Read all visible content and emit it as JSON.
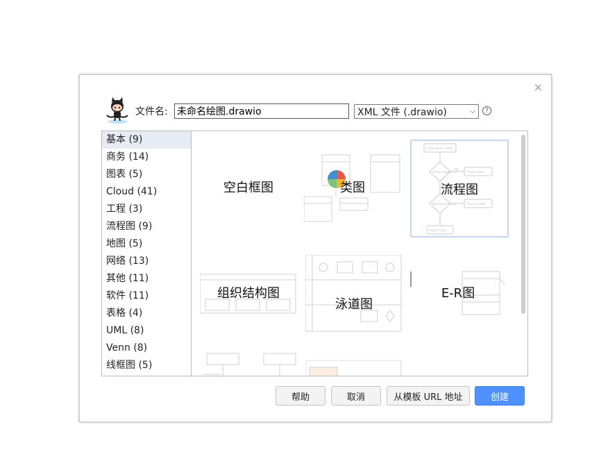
{
  "dialog": {
    "filename_label": "文件名:",
    "filename_value": "未命名绘图.drawio",
    "format_value": "XML 文件 (.drawio)",
    "help_icon_glyph": "?",
    "close_glyph": "×"
  },
  "categories": [
    {
      "label": "基本 (9)",
      "selected": true
    },
    {
      "label": "商务 (14)"
    },
    {
      "label": "图表 (5)"
    },
    {
      "label": "Cloud (41)"
    },
    {
      "label": "工程 (3)"
    },
    {
      "label": "流程图 (9)"
    },
    {
      "label": "地图 (5)"
    },
    {
      "label": "网络 (13)"
    },
    {
      "label": "其他 (11)"
    },
    {
      "label": "软件 (11)"
    },
    {
      "label": "表格 (4)"
    },
    {
      "label": "UML (8)"
    },
    {
      "label": "Venn (8)"
    },
    {
      "label": "线框图 (5)"
    }
  ],
  "templates": {
    "blank": "空白框图",
    "class": "类图",
    "flowchart": "流程图",
    "org": "组织结构图",
    "swimlane": "泳道图",
    "er": "E-R图"
  },
  "flowchart_thumb_texts": [
    "Lamp doesn't work",
    "Lamp plugged in?",
    "Plug in lamp",
    "Bulb burned out?",
    "Replace Bulb",
    "Repair Lamp",
    "No",
    "Yes"
  ],
  "buttons": {
    "help": "帮助",
    "cancel": "取消",
    "from_url": "从模板 URL 地址",
    "create": "创建"
  },
  "colors": {
    "primary_button": "#4d90fe",
    "selected_category": "#e6ebf4",
    "selected_template_border": "#c6d6ee"
  },
  "icons": {
    "logo": "octocat-icon",
    "close": "close-icon",
    "help": "help-icon"
  }
}
